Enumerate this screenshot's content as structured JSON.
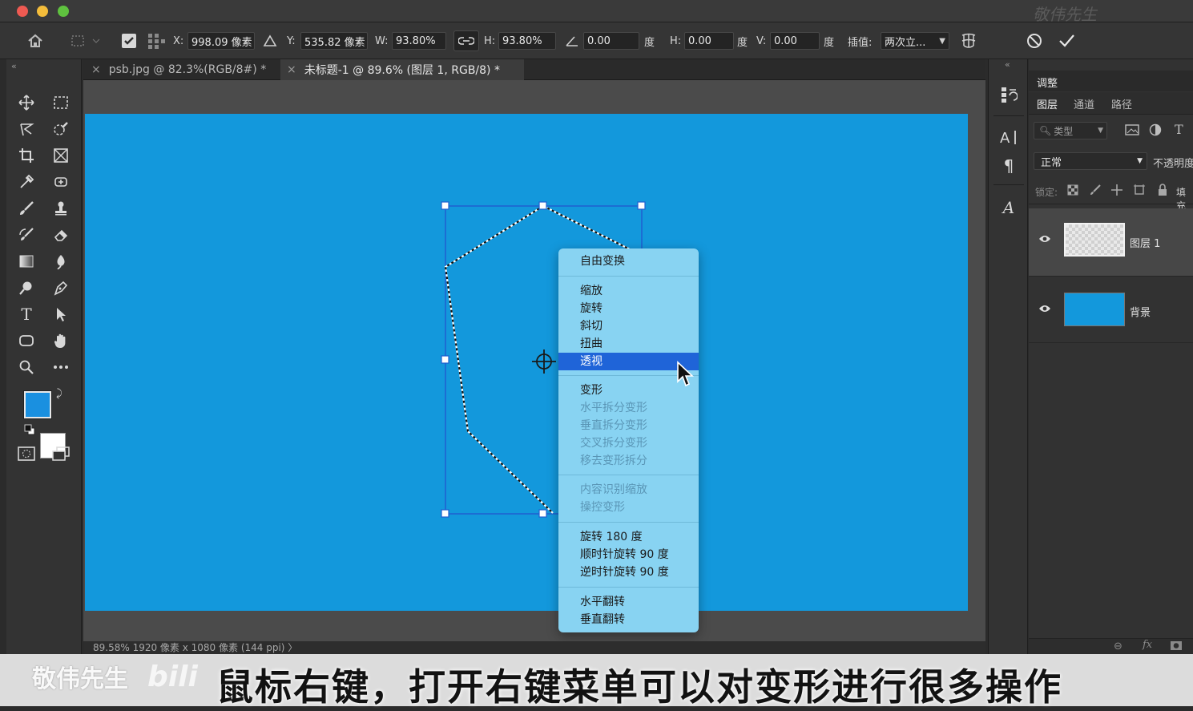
{
  "watermark": "敬伟先生",
  "colors": {
    "canvas": "#1398dc",
    "menu_bg": "#88d3f2",
    "menu_selected": "#1f64d8",
    "foreground_swatch": "#1a90e0",
    "background_swatch": "#ffffff"
  },
  "options_bar": {
    "x_label": "X:",
    "x_value": "998.09 像素",
    "y_label": "Y:",
    "y_value": "535.82 像素",
    "w_label": "W:",
    "w_value": "93.80%",
    "h_label": "H:",
    "h_value": "93.80%",
    "angle_value": "0.00",
    "angle_unit": "度",
    "hskew_label": "H:",
    "hskew_value": "0.00",
    "hskew_unit": "度",
    "vskew_label": "V:",
    "vskew_value": "0.00",
    "vskew_unit": "度",
    "interp_label": "插值:",
    "interp_value": "两次立..."
  },
  "tabs": [
    {
      "label": "psb.jpg @ 82.3%(RGB/8#) *"
    },
    {
      "label": "未标题-1 @ 89.6% (图层 1, RGB/8) *"
    }
  ],
  "context_menu": {
    "items": [
      {
        "label": "自由变换",
        "state": "enabled"
      },
      {
        "label": "缩放",
        "state": "enabled"
      },
      {
        "label": "旋转",
        "state": "enabled"
      },
      {
        "label": "斜切",
        "state": "enabled"
      },
      {
        "label": "扭曲",
        "state": "enabled"
      },
      {
        "label": "透视",
        "state": "selected"
      },
      {
        "label": "变形",
        "state": "enabled"
      },
      {
        "label": "水平拆分变形",
        "state": "disabled"
      },
      {
        "label": "垂直拆分变形",
        "state": "disabled"
      },
      {
        "label": "交叉拆分变形",
        "state": "disabled"
      },
      {
        "label": "移去变形拆分",
        "state": "disabled"
      },
      {
        "label": "内容识别缩放",
        "state": "disabled"
      },
      {
        "label": "操控变形",
        "state": "disabled"
      },
      {
        "label": "旋转 180 度",
        "state": "enabled"
      },
      {
        "label": "顺时针旋转 90 度",
        "state": "enabled"
      },
      {
        "label": "逆时针旋转 90 度",
        "state": "enabled"
      },
      {
        "label": "水平翻转",
        "state": "enabled"
      },
      {
        "label": "垂直翻转",
        "state": "enabled"
      }
    ]
  },
  "panel": {
    "adjust_tab": "调整",
    "tabs": [
      "图层",
      "通道",
      "路径"
    ],
    "filter_placeholder": "类型",
    "blend_mode": "正常",
    "opacity_label": "不透明度",
    "lock_label": "锁定:",
    "fill_label": "填充",
    "layers": [
      {
        "name": "图层 1"
      },
      {
        "name": "背景"
      }
    ]
  },
  "status_bar": "89.58%   1920 像素 x 1080 像素 (144 ppi)  〉",
  "subtitle": "鼠标右键，打开右键菜单可以对变形进行很多操作",
  "brand": "敬伟先生",
  "brand_logo": "bili"
}
